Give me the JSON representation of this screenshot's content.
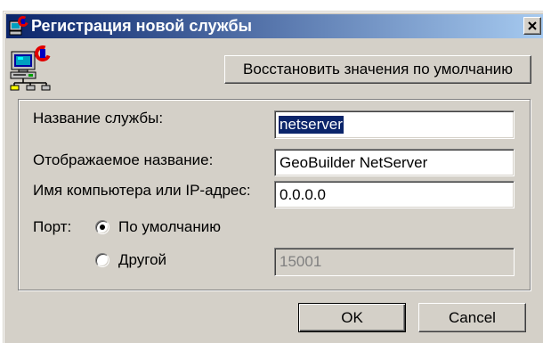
{
  "window": {
    "title": "Регистрация новой службы",
    "icon": "app-icon",
    "close_icon": "close-icon"
  },
  "header": {
    "icon": "network-computer-icon",
    "restore_defaults_label": "Восстановить значения по умолчанию"
  },
  "form": {
    "service_name": {
      "label": "Название службы:",
      "value": "netserver",
      "selected": true
    },
    "display_name": {
      "label": "Отображаемое название:",
      "value": "GeoBuilder NetServer"
    },
    "host": {
      "label": "Имя компьютера или IP-адрес:",
      "value": "0.0.0.0"
    },
    "port": {
      "label": "Порт:",
      "options": [
        {
          "label": "По умолчанию",
          "checked": true
        },
        {
          "label": "Другой",
          "checked": false
        }
      ],
      "custom_value": "15001",
      "custom_disabled": true
    }
  },
  "footer": {
    "ok_label": "OK",
    "cancel_label": "Cancel"
  },
  "colors": {
    "title_start": "#0a246a",
    "title_end": "#a6caf0",
    "face": "#d4d0c8",
    "selection": "#0a246a",
    "disabled_text": "#808080"
  }
}
